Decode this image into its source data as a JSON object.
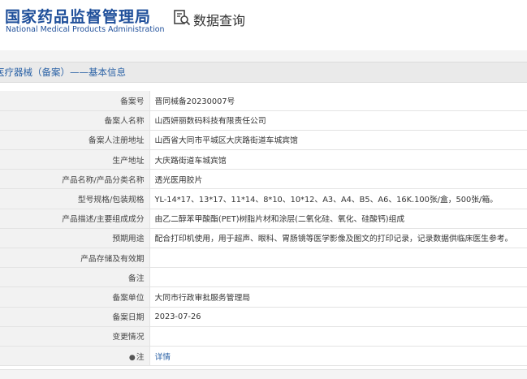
{
  "header": {
    "logo_cn": "国家药品监督管理局",
    "logo_en": "National Medical Products Administration",
    "query_icon": "search-document-icon",
    "query_title": "数据查询"
  },
  "section": {
    "title": "医疗器械（备案）——基本信息"
  },
  "rows": [
    {
      "label": "备案号",
      "value": "晋同械备20230007号"
    },
    {
      "label": "备案人名称",
      "value": "山西妍丽数码科技有限责任公司"
    },
    {
      "label": "备案人注册地址",
      "value": "山西省大同市平城区大庆路街道车城宾馆"
    },
    {
      "label": "生产地址",
      "value": "大庆路街道车城宾馆"
    },
    {
      "label": "产品名称/产品分类名称",
      "value": "透光医用胶片"
    },
    {
      "label": "型号规格/包装规格",
      "value": "YL-14*17、13*17、11*14、8*10、10*12、A3、A4、B5、A6、16K.100张/盒，500张/箱。"
    },
    {
      "label": "产品描述/主要组成成分",
      "value": "由乙二醇苯甲酸酯(PET)树脂片材和涂层(二氧化硅、氧化、硅酸钙)组成"
    },
    {
      "label": "预期用途",
      "value": "配合打印机使用，用于超声、眼科、胃肠镜等医学影像及图文的打印记录，记录数据供临床医生参考。"
    },
    {
      "label": "产品存储及有效期",
      "value": ""
    },
    {
      "label": "备注",
      "value": ""
    },
    {
      "label": "备案单位",
      "value": "大同市行政审批服务管理局"
    },
    {
      "label": "备案日期",
      "value": "2023-07-26"
    },
    {
      "label": "变更情况",
      "value": ""
    },
    {
      "label": "注",
      "value": "详情",
      "is_link": true
    }
  ]
}
